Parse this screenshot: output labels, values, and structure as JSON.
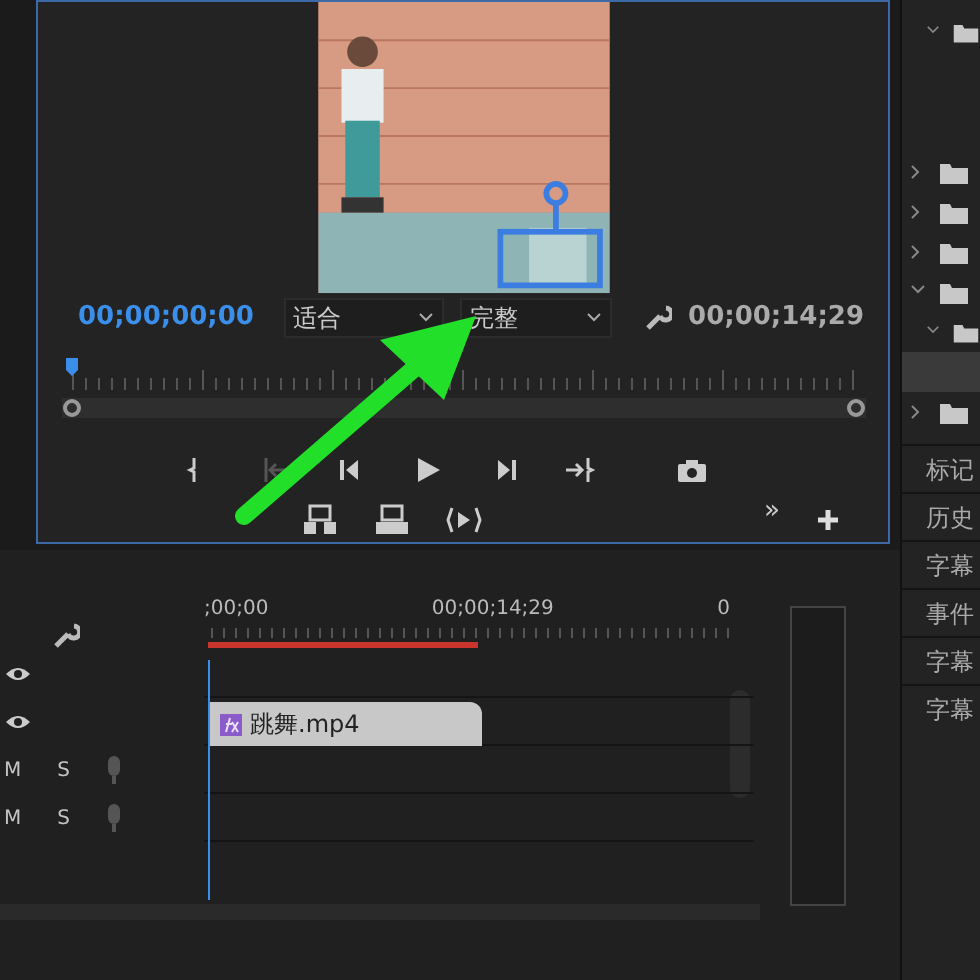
{
  "monitor": {
    "current_time": "00;00;00;00",
    "zoom_select": "适合",
    "quality_select": "完整",
    "duration": "00;00;14;29",
    "playhead": {
      "level": 0
    },
    "more": "»"
  },
  "timeline": {
    "ruler_labels": [
      ";00;00",
      "00;00;14;29",
      "0"
    ],
    "work_area": {
      "level": 0.36
    },
    "video_tracks": [
      {
        "visible": true
      },
      {
        "visible": true,
        "clip": "跳舞.mp4"
      }
    ],
    "audio_tracks": [
      {
        "mute": "M",
        "solo": "S"
      },
      {
        "mute": "M",
        "solo": "S"
      }
    ]
  },
  "panel_items": [
    "标记",
    "历史",
    "字幕",
    "事件",
    "字幕",
    "字幕"
  ]
}
